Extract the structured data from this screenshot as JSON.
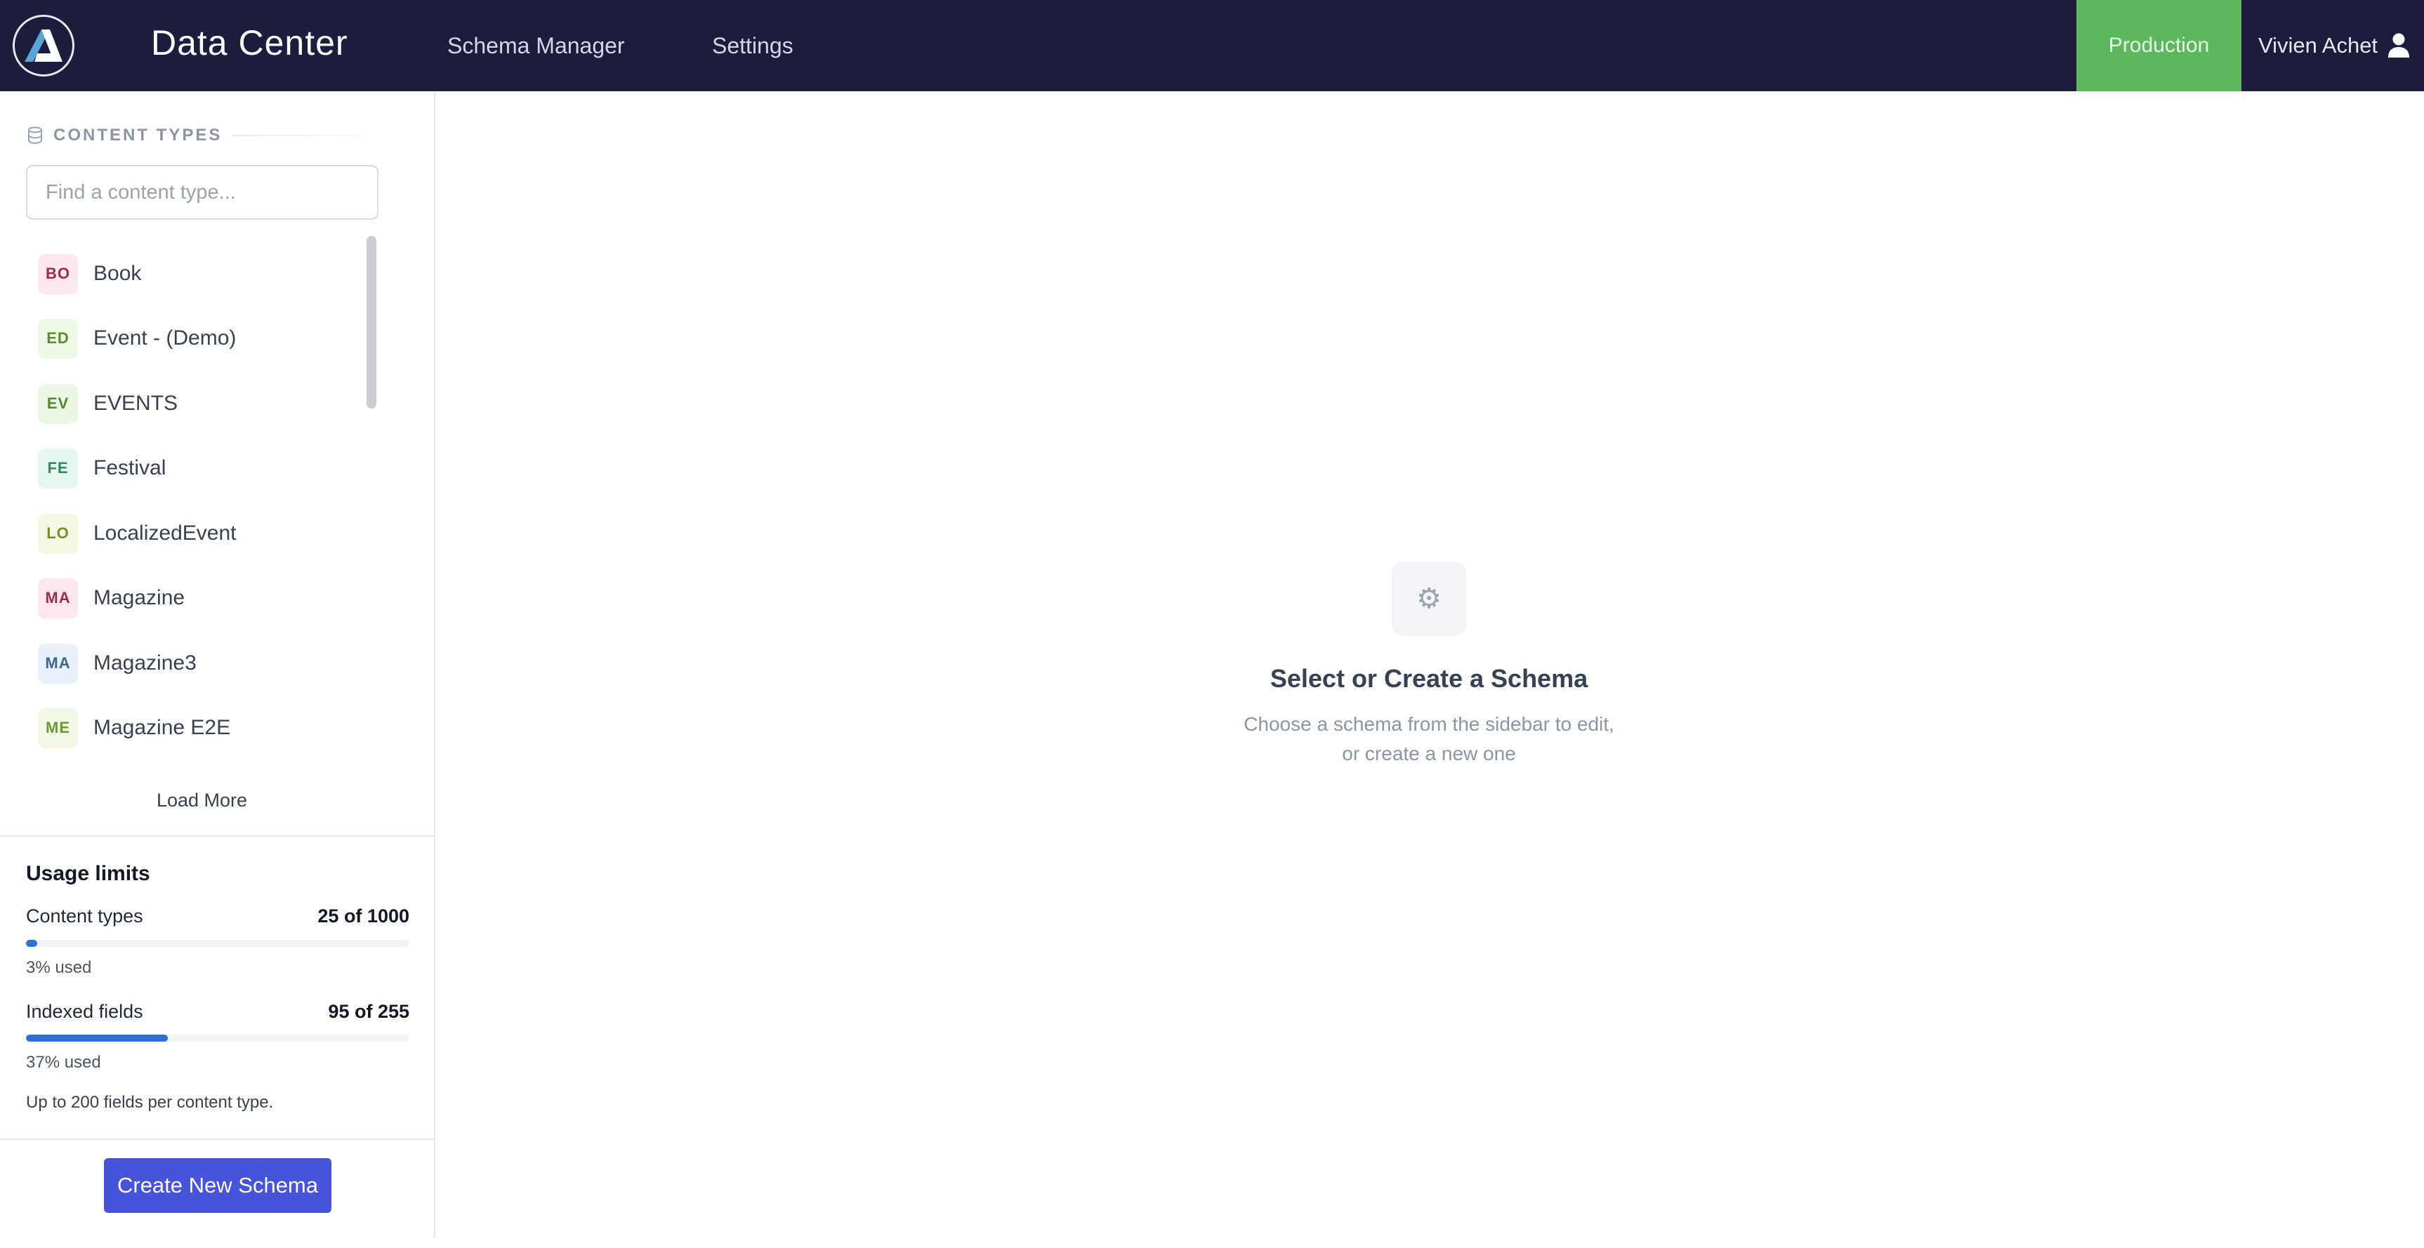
{
  "header": {
    "title": "Data Center",
    "nav": [
      "Schema Manager",
      "Settings"
    ],
    "environment": "Production",
    "user_name": "Vivien Achet",
    "colors": {
      "bar": "#1c1c3c",
      "environment": "#5cb85c"
    }
  },
  "sidebar": {
    "section_label": "CONTENT TYPES",
    "search_placeholder": "Find a content type...",
    "content_types": [
      {
        "initials": "BO",
        "name": "Book",
        "bg": "#fde7ec",
        "fg": "#9b2c4a"
      },
      {
        "initials": "ED",
        "name": "Event - (Demo)",
        "bg": "#eef8e6",
        "fg": "#5d8a2a"
      },
      {
        "initials": "EV",
        "name": "EVENTS",
        "bg": "#e9f7e4",
        "fg": "#4e8a2c"
      },
      {
        "initials": "FE",
        "name": "Festival",
        "bg": "#e6f7ef",
        "fg": "#2f8a5c"
      },
      {
        "initials": "LO",
        "name": "LocalizedEvent",
        "bg": "#f4f8e3",
        "fg": "#7a8a26"
      },
      {
        "initials": "MA",
        "name": "Magazine",
        "bg": "#fde7ec",
        "fg": "#9b2c4a"
      },
      {
        "initials": "MA",
        "name": "Magazine3",
        "bg": "#e8f1fb",
        "fg": "#3a6696"
      },
      {
        "initials": "ME",
        "name": "Magazine E2E",
        "bg": "#f0f8e6",
        "fg": "#6a9a2c"
      }
    ],
    "load_more": "Load More",
    "usage": {
      "title": "Usage limits",
      "items": [
        {
          "label": "Content types",
          "value": "25 of 1000",
          "percent": 3,
          "used_text": "3% used"
        },
        {
          "label": "Indexed fields",
          "value": "95 of 255",
          "percent": 37,
          "used_text": "37% used"
        }
      ],
      "note": "Up to 200 fields per content type."
    },
    "create_button": "Create New Schema",
    "colors": {
      "button": "#4753d8",
      "progress": "#2f6fd6"
    }
  },
  "main": {
    "icon": "gear-icon",
    "title": "Select or Create a Schema",
    "subtitle_lines": [
      "Choose a schema from the sidebar to edit,",
      "or create a new one"
    ]
  }
}
